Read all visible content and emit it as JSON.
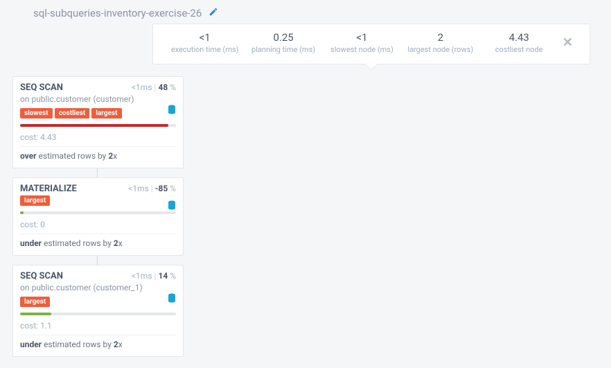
{
  "title": "sql-subqueries-inventory-exercise-26",
  "stats": {
    "exec": {
      "val": "<1",
      "lbl": "execution time (ms)"
    },
    "plan": {
      "val": "0.25",
      "lbl": "planning time (ms)"
    },
    "slow": {
      "val": "<1",
      "lbl": "slowest node (ms)"
    },
    "large": {
      "val": "2",
      "lbl": "largest node (rows)"
    },
    "cost": {
      "val": "4.43",
      "lbl": "costliest node"
    }
  },
  "nodes": [
    {
      "type": "SEQ SCAN",
      "time": "<1ms",
      "pct": "48",
      "sub_prefix": "on ",
      "sub": "public.customer (customer)",
      "badges": [
        "slowest",
        "costliest",
        "largest"
      ],
      "bar_width": "95%",
      "bar_class": "bar-red",
      "cost_label": "cost: ",
      "cost": "4.43",
      "est_dir": "over",
      "est_mid": " estimated rows by ",
      "est_factor": "2",
      "est_suffix": "x",
      "has_sub": true
    },
    {
      "type": "MATERIALIZE",
      "time": "<1ms",
      "pct": "-85",
      "sub_prefix": "",
      "sub": "",
      "badges": [
        "largest"
      ],
      "bar_width": "2%",
      "bar_class": "bar-green",
      "cost_label": "cost: ",
      "cost": "0",
      "est_dir": "under",
      "est_mid": " estimated rows by ",
      "est_factor": "2",
      "est_suffix": "x",
      "has_sub": false
    },
    {
      "type": "SEQ SCAN",
      "time": "<1ms",
      "pct": "14",
      "sub_prefix": "on ",
      "sub": "public.customer (customer_1)",
      "badges": [
        "largest"
      ],
      "bar_width": "20%",
      "bar_class": "bar-green",
      "cost_label": "cost: ",
      "cost": "1.1",
      "est_dir": "under",
      "est_mid": " estimated rows by ",
      "est_factor": "2",
      "est_suffix": "x",
      "has_sub": true
    }
  ],
  "pct_suffix": " %"
}
